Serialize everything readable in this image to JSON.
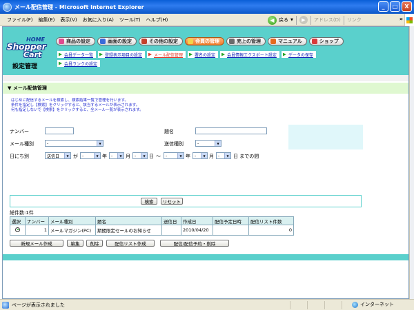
{
  "window": {
    "title": "メール配信管理 - Microsoft Internet Explorer",
    "controls": {
      "minimize": "_",
      "maximize": "□",
      "close": "X"
    }
  },
  "menubar": {
    "items": [
      "ファイル(F)",
      "編集(E)",
      "表示(V)",
      "お気に入り(A)",
      "ツール(T)",
      "ヘルプ(H)"
    ],
    "back_label": "戻る",
    "address_label": "アドレス(D)",
    "links_label": "リンク",
    "overflow": "»"
  },
  "logo": {
    "home": "HOME",
    "shopper": "Shopper",
    "cart": "Cart",
    "sub": "設定管理"
  },
  "nav": {
    "tabs": [
      {
        "label": "商品の設定",
        "icon_color": "#e14b8f"
      },
      {
        "label": "画面の設定",
        "icon_color": "#3a6bd9"
      },
      {
        "label": "その他の設定",
        "icon_color": "#c4402b"
      },
      {
        "label": "会員の管理",
        "icon_color": "#f5d34a",
        "active": true
      },
      {
        "label": "売上の管理",
        "icon_color": "#6b6b6b"
      },
      {
        "label": "マニュアル",
        "icon_color": "#e56a1e"
      },
      {
        "label": "ショップ",
        "icon_color": "#d93a3a"
      }
    ],
    "subitems": [
      {
        "label": "会員データ一覧"
      },
      {
        "label": "登録表示項目の設定"
      },
      {
        "label": "メール配信管理",
        "active": true
      },
      {
        "label": "署名の設定"
      },
      {
        "label": "会員情報エクスポート設定"
      },
      {
        "label": "データの保存"
      },
      {
        "label": "会員ランクの設定"
      }
    ]
  },
  "section": {
    "title": "▼ メール配信管理",
    "intro": [
      "はじめに配信するメールを検索し、検索結果一覧で管理を行います。",
      "条件を指定し【検索】をクリックすると、該当するメールが表示されます。",
      "何も指定しないで【検索】をクリックすると、全メール一覧が表示されます。"
    ]
  },
  "form": {
    "number_label": "ナンバー",
    "subject_label": "題名",
    "mail_type_label": "メール種別",
    "mail_type_value": "-",
    "send_type_label": "送信種別",
    "send_type_value": "-",
    "date_label": "日にち別",
    "date_field_value": "送信日",
    "ga": "が",
    "dash": "-",
    "year": "年",
    "month": "月",
    "day": "日",
    "tilde": "～",
    "until": "日 までの間"
  },
  "buttons": {
    "search": "検索",
    "reset": "リセット",
    "new_mail": "新規メール作成",
    "edit": "編集",
    "delete": "削除",
    "create_list": "配信リスト作成",
    "schedule": "配信/配信予約・削除"
  },
  "results": {
    "total_label": "総件数:1件",
    "headers": [
      "選択",
      "ナンバー",
      "メール種別",
      "題名",
      "送信日",
      "作成日",
      "配信予定日時",
      "配信リスト件数"
    ],
    "rows": [
      {
        "number": "1",
        "type": "メールマガジン(PC)",
        "subject": "期間限定セールのお知らせ",
        "sent": "",
        "created": "2010/04/20",
        "scheduled": "",
        "list_count": "0"
      }
    ]
  },
  "statusbar": {
    "text": "ページが表示されました",
    "zone": "インターネット"
  }
}
